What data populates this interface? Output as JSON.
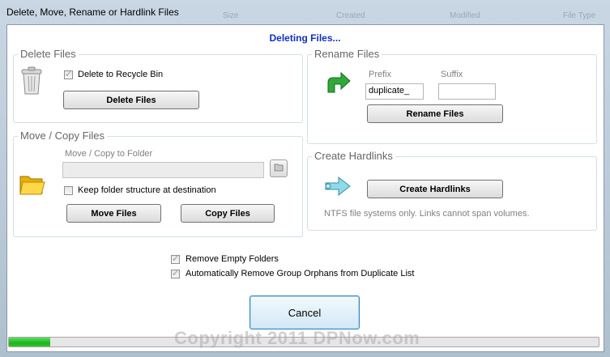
{
  "window": {
    "title": "Delete, Move, Rename or Hardlink Files",
    "background_columns": [
      "Size",
      "Created",
      "Modified",
      "File Type"
    ]
  },
  "status_text": "Deleting Files...",
  "delete_group": {
    "label": "Delete Files",
    "icon": "trash-can-icon",
    "recycle_label": "Delete to Recycle Bin",
    "recycle_checked": true,
    "button": "Delete Files"
  },
  "move_group": {
    "label": "Move / Copy Files",
    "icon": "folder-icon",
    "folder_label": "Move / Copy to Folder",
    "folder_value": "",
    "browse_icon": "browse-folder-icon",
    "keep_structure_label": "Keep folder structure at destination",
    "keep_structure_checked": false,
    "move_button": "Move Files",
    "copy_button": "Copy Files"
  },
  "rename_group": {
    "label": "Rename Files",
    "icon": "rename-arrow-icon",
    "prefix_label": "Prefix",
    "prefix_value": "duplicate_",
    "suffix_label": "Suffix",
    "suffix_value": "",
    "button": "Rename Files"
  },
  "hardlink_group": {
    "label": "Create Hardlinks",
    "icon": "hardlink-arrow-icon",
    "button": "Create Hardlinks",
    "note": "NTFS file systems only.  Links cannot span volumes."
  },
  "options": {
    "remove_empty_label": "Remove Empty Folders",
    "remove_empty_checked": true,
    "remove_orphans_label": "Automatically Remove Group Orphans from Duplicate List",
    "remove_orphans_checked": true
  },
  "cancel_button": "Cancel",
  "progress": {
    "fraction": 0.07,
    "color": "#22c022"
  },
  "watermark": "Copyright 2011 DPNow.com"
}
